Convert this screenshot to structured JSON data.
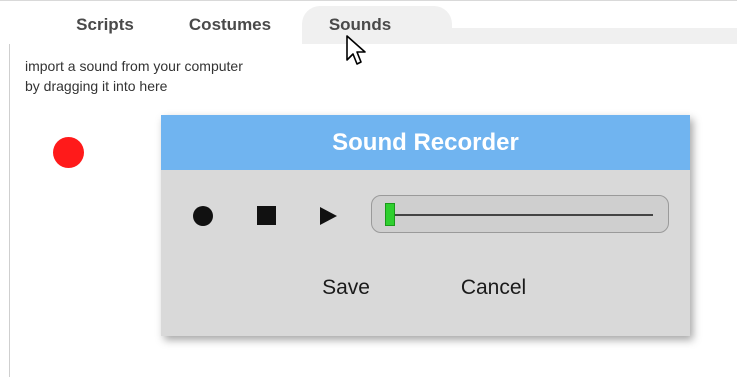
{
  "tabs": [
    {
      "label": "Scripts"
    },
    {
      "label": "Costumes"
    },
    {
      "label": "Sounds",
      "active": true
    }
  ],
  "hint": {
    "line1": "import a sound from your computer",
    "line2": "by dragging it into here"
  },
  "dialog": {
    "title": "Sound Recorder",
    "save_label": "Save",
    "cancel_label": "Cancel",
    "level_fraction": 0.02
  },
  "colors": {
    "title_bar": "#70b4f0",
    "dialog_bg": "#d9d9d9",
    "record_indicator": "#ff1a1a",
    "level_green": "#2fcf2f"
  },
  "icons": [
    "record-icon",
    "stop-icon",
    "play-icon",
    "mouse-pointer-icon"
  ]
}
